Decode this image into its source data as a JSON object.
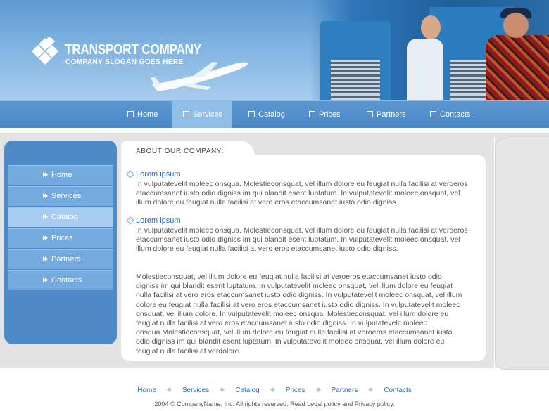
{
  "brand": {
    "title": "TRANSPORT COMPANY",
    "slogan": "COMPANY SLOGAN GOES HERE"
  },
  "top_nav": {
    "active": "Services",
    "items": [
      {
        "label": "Home",
        "icon": "box-icon"
      },
      {
        "label": "Services",
        "icon": "box-icon"
      },
      {
        "label": "Catalog",
        "icon": "box-icon"
      },
      {
        "label": "Prices",
        "icon": "box-icon"
      },
      {
        "label": "Partners",
        "icon": "box-icon"
      },
      {
        "label": "Contacts",
        "icon": "box-icon"
      }
    ]
  },
  "sidebar": {
    "active": "Catalog",
    "items": [
      {
        "label": "Home",
        "icon": "arrow-icon"
      },
      {
        "label": "Services",
        "icon": "arrow-icon"
      },
      {
        "label": "Catalog",
        "icon": "arrow-icon"
      },
      {
        "label": "Prices",
        "icon": "arrow-icon"
      },
      {
        "label": "Partners",
        "icon": "arrow-icon"
      },
      {
        "label": "Contacts",
        "icon": "arrow-icon"
      }
    ]
  },
  "main": {
    "heading": "ABOUT OUR COMPANY:",
    "sections": [
      {
        "title": "Lorem ipsum",
        "text": "In vulputatevelit moleec onsqua. Molestieconsquat, vel illum dolore eu feugiat nulla facilisi at veroeros etaccumsanet iusto odio digniss im qui blandit esent luptatum. In vulputatevelit moleec onsquat, vel illum dolore eu feugiat nulla facilisi at vero eros etaccumsanet iusto odio digniss."
      },
      {
        "title": "Lorem ipsum",
        "text": "In vulputatevelit moleec onsqua. Molestieconsquat, vel illum dolore eu feugiat nulla facilisi at veroeros etaccumsanet iusto odio digniss im qui blandit esent luptatum. In vulputatevelit moleec onsquat, vel illum dolore eu feugiat nulla facilisi at vero eros etaccumsanet iusto odio digniss."
      }
    ],
    "long_paragraph": "Molestieconsquat, vel illum dolore eu feugiat nulla facilisi at veroeros etaccumsanet iusto odio digniss im qui blandit esent luptatum. In vulputatevelit moleec onsquat, vel illum dolore eu feugiat nulla facilisi at vero eros etaccumsanet iusto odio digniss. In vulputatevelit moleec onsquat, vel illum dolore eu feugiat nulla facilisi at vero eros etaccumsanet iusto odio digniss. In vulputatevelit moleec onsquat, vel illum dolore. In vulputatevelit moleec onsqua. Molestieconsquat, vel illum dolore eu feugiat nulla facilisi at vero eros etaccumsanet iusto odio digniss. In vulputatevelit moleec onsqua.Molestieconsquat, vel illum dolore eu feugiat nulla facilisi at veroeros etaccumsanet iusto odio digniss im qui blandit esent luptatum. In vulputatevelit moleec onsquat, vel illum dolore eu feugiat nulla facilisi at verdolore."
  },
  "footer": {
    "links": [
      "Home",
      "Services",
      "Catalog",
      "Prices",
      "Partners",
      "Contacts"
    ],
    "copyright": "2004 © CompanyName, Inc. All rights reserved. Read Legal policy and Privacy policy."
  },
  "colors": {
    "nav_blue": "#4a87c6",
    "link_blue": "#2b6fc0",
    "sidebar_blue": "#4e89c8",
    "band_gray": "#e3e3e3"
  }
}
